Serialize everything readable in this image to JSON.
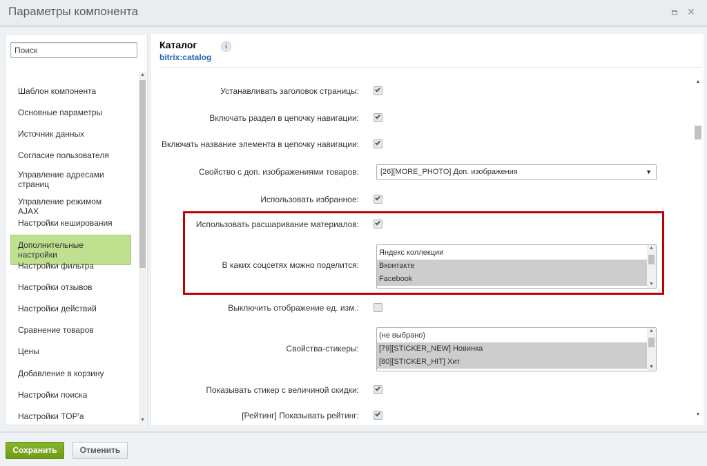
{
  "window": {
    "title": "Параметры компонента",
    "maximize_icon": "maximize-icon",
    "close_icon": "close-icon",
    "close_glyph": "✕"
  },
  "sidebar": {
    "search_placeholder": "Поиск",
    "items": [
      {
        "label": "Шаблон компонента"
      },
      {
        "label": "Основные параметры"
      },
      {
        "label": "Источник данных"
      },
      {
        "label": "Согласие пользователя"
      },
      {
        "label": "Управление адресами страниц"
      },
      {
        "label": "Управление режимом AJAX"
      },
      {
        "label": "Настройки кеширования"
      },
      {
        "label": "Дополнительные настройки",
        "active": true
      },
      {
        "label": "Настройки фильтра"
      },
      {
        "label": "Настройки отзывов"
      },
      {
        "label": "Настройки действий"
      },
      {
        "label": "Сравнение товаров"
      },
      {
        "label": "Цены"
      },
      {
        "label": "Добавление в корзину"
      },
      {
        "label": "Настройки поиска"
      },
      {
        "label": "Настройки TOP'а"
      }
    ]
  },
  "component": {
    "title": "Каталог",
    "code": "bitrix:catalog",
    "info_glyph": "i"
  },
  "settings": {
    "set_title": {
      "label": "Устанавливать заголовок страницы:",
      "checked": true
    },
    "add_section_chain": {
      "label": "Включать раздел в цепочку навигации:",
      "checked": true
    },
    "add_element_chain": {
      "label": "Включать название элемента в цепочку навигации:",
      "checked": true
    },
    "more_photo_property": {
      "label": "Свойство с доп. изображениями товаров:",
      "value": "[26][MORE_PHOTO] Доп. изображения"
    },
    "use_favorites": {
      "label": "Использовать избранное:",
      "checked": true
    },
    "use_share": {
      "label": "Использовать расшаривание материалов:",
      "checked": true
    },
    "share_networks": {
      "label": "В каких соцсетях можно поделится:",
      "options": [
        {
          "text": "Яндекс коллекции",
          "selected": false
        },
        {
          "text": "Вконтакте",
          "selected": true
        },
        {
          "text": "Facebook",
          "selected": true
        }
      ]
    },
    "hide_measures": {
      "label": "Выключить отображение ед. изм.:",
      "checked": false
    },
    "sticker_props": {
      "label": "Свойства-стикеры:",
      "options": [
        {
          "text": "(не выбрано)",
          "selected": false
        },
        {
          "text": "[79][STICKER_NEW] Новинка",
          "selected": true
        },
        {
          "text": "[80][STICKER_HIT] Хит",
          "selected": true
        }
      ]
    },
    "show_discount_sticker": {
      "label": "Показывать стикер с величиной скидки:",
      "checked": true
    },
    "show_rating": {
      "label": "[Рейтинг] Показывать рейтинг:",
      "checked": true
    }
  },
  "footer": {
    "save_label": "Сохранить",
    "cancel_label": "Отменить"
  },
  "colors": {
    "accent_green": "#6f9c17",
    "active_item": "#bfe08f",
    "highlight_red": "#c00000",
    "link_blue": "#2067b0"
  }
}
